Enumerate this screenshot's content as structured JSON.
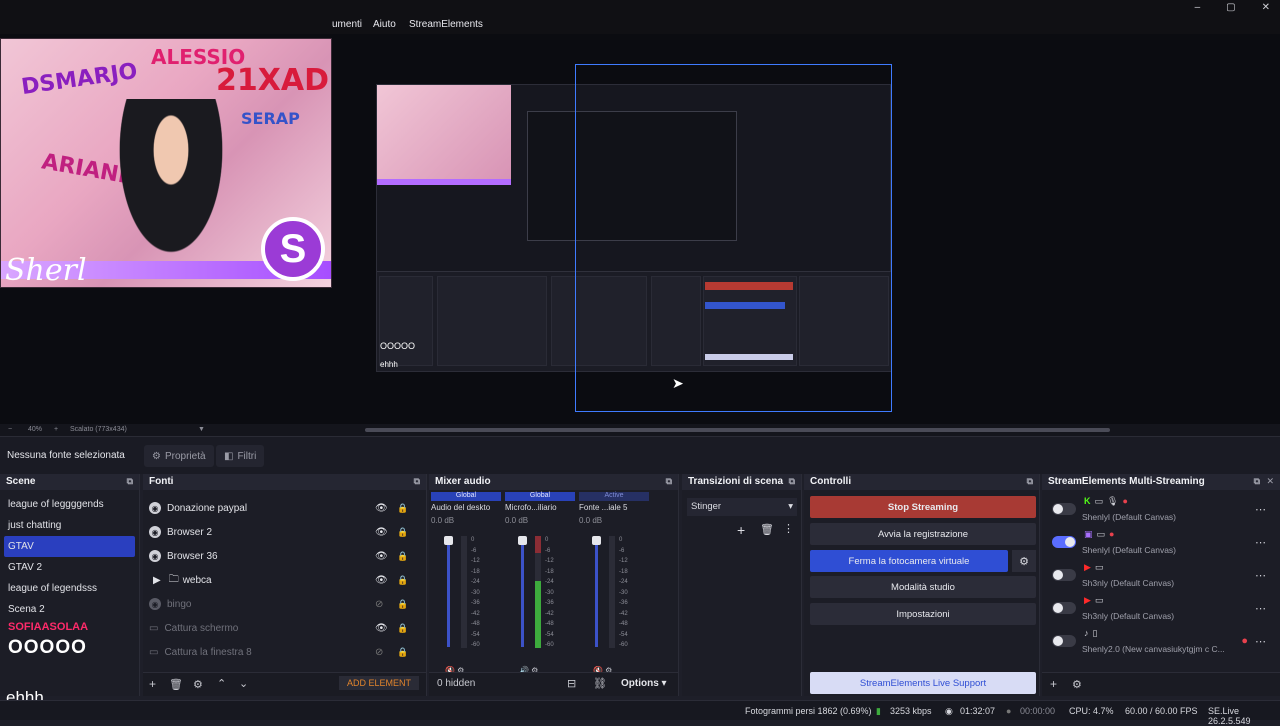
{
  "menu": {
    "items": [
      "umenti",
      "Aiuto",
      "StreamElements"
    ]
  },
  "window_controls": [
    "–",
    "▢",
    "✕"
  ],
  "preview": {
    "zoom": "40%",
    "scale_label": "Scalato (773x434)",
    "webcam_signature": "Sherl",
    "nested_overlay_1": "OOOOO",
    "nested_overlay_2": "ehhh"
  },
  "source_toolbar": {
    "no_source": "Nessuna fonte selezionata",
    "properties": "Proprietà",
    "filters": "Filtri"
  },
  "scenes": {
    "title": "Scene",
    "items": [
      "league of leggggends",
      "just chatting",
      "GTAV",
      "GTAV 2",
      "league of legendsss",
      "Scena 2"
    ],
    "active_index": 2
  },
  "sources": {
    "title": "Fonti",
    "items": [
      {
        "name": "Donazione paypal",
        "dim": false
      },
      {
        "name": "Browser 2",
        "dim": false
      },
      {
        "name": "Browser 36",
        "dim": false
      },
      {
        "name": "webca",
        "dim": false
      },
      {
        "name": "bingo",
        "dim": true
      },
      {
        "name": "Cattura schermo",
        "dim": true
      },
      {
        "name": "Cattura la finestra 8",
        "dim": true
      }
    ],
    "add_element": "ADD ELEMENT"
  },
  "mixer": {
    "title": "Mixer audio",
    "channels": [
      {
        "tag": "Global",
        "name": "Audio del deskto",
        "db": "0.0 dB"
      },
      {
        "tag": "Global",
        "name": "Microfo...iliario",
        "db": "0.0 dB"
      },
      {
        "tag": "Active",
        "name": "Fonte ...iale 5",
        "db": "0.0 dB"
      }
    ],
    "scale": [
      "0",
      "-6",
      "-12",
      "-18",
      "-24",
      "-30",
      "-36",
      "-42",
      "-48",
      "-54",
      "-60"
    ],
    "hidden": "0 hidden",
    "options": "Options"
  },
  "transitions": {
    "title": "Transizioni di scena",
    "selected": "Stinger"
  },
  "controls": {
    "title": "Controlli",
    "stop_streaming": "Stop Streaming",
    "start_recording": "Avvia la registrazione",
    "stop_virtual_cam": "Ferma la fotocamera virtuale",
    "studio_mode": "Modalità studio",
    "settings": "Impostazioni",
    "live_support": "StreamElements Live Support"
  },
  "multistream": {
    "title": "StreamElements Multi-Streaming",
    "rows": [
      {
        "label": "Shenlyl (Default Canvas)",
        "on": false,
        "platform": "K"
      },
      {
        "label": "Shenlyl (Default Canvas)",
        "on": true,
        "platform": "T"
      },
      {
        "label": "Sh3nly (Default Canvas)",
        "on": false,
        "platform": "Y"
      },
      {
        "label": "Sh3nly (Default Canvas)",
        "on": false,
        "platform": "Y"
      },
      {
        "label": "Shenly2.0 (New canvasiukytgjm c C...",
        "on": false,
        "platform": "TT"
      }
    ]
  },
  "overlay": {
    "text1": "SOFIAASOLAA",
    "text2": "OOOOO",
    "text3": "ehhh"
  },
  "status": {
    "dropped": "Fotogrammi persi 1862 (0.69%)",
    "bitrate": "3253 kbps",
    "stream_time": "01:32:07",
    "rec_time": "00:00:00",
    "cpu": "CPU: 4.7%",
    "fps": "60.00 / 60.00 FPS",
    "version": "SE.Live 26.2.5.549"
  }
}
